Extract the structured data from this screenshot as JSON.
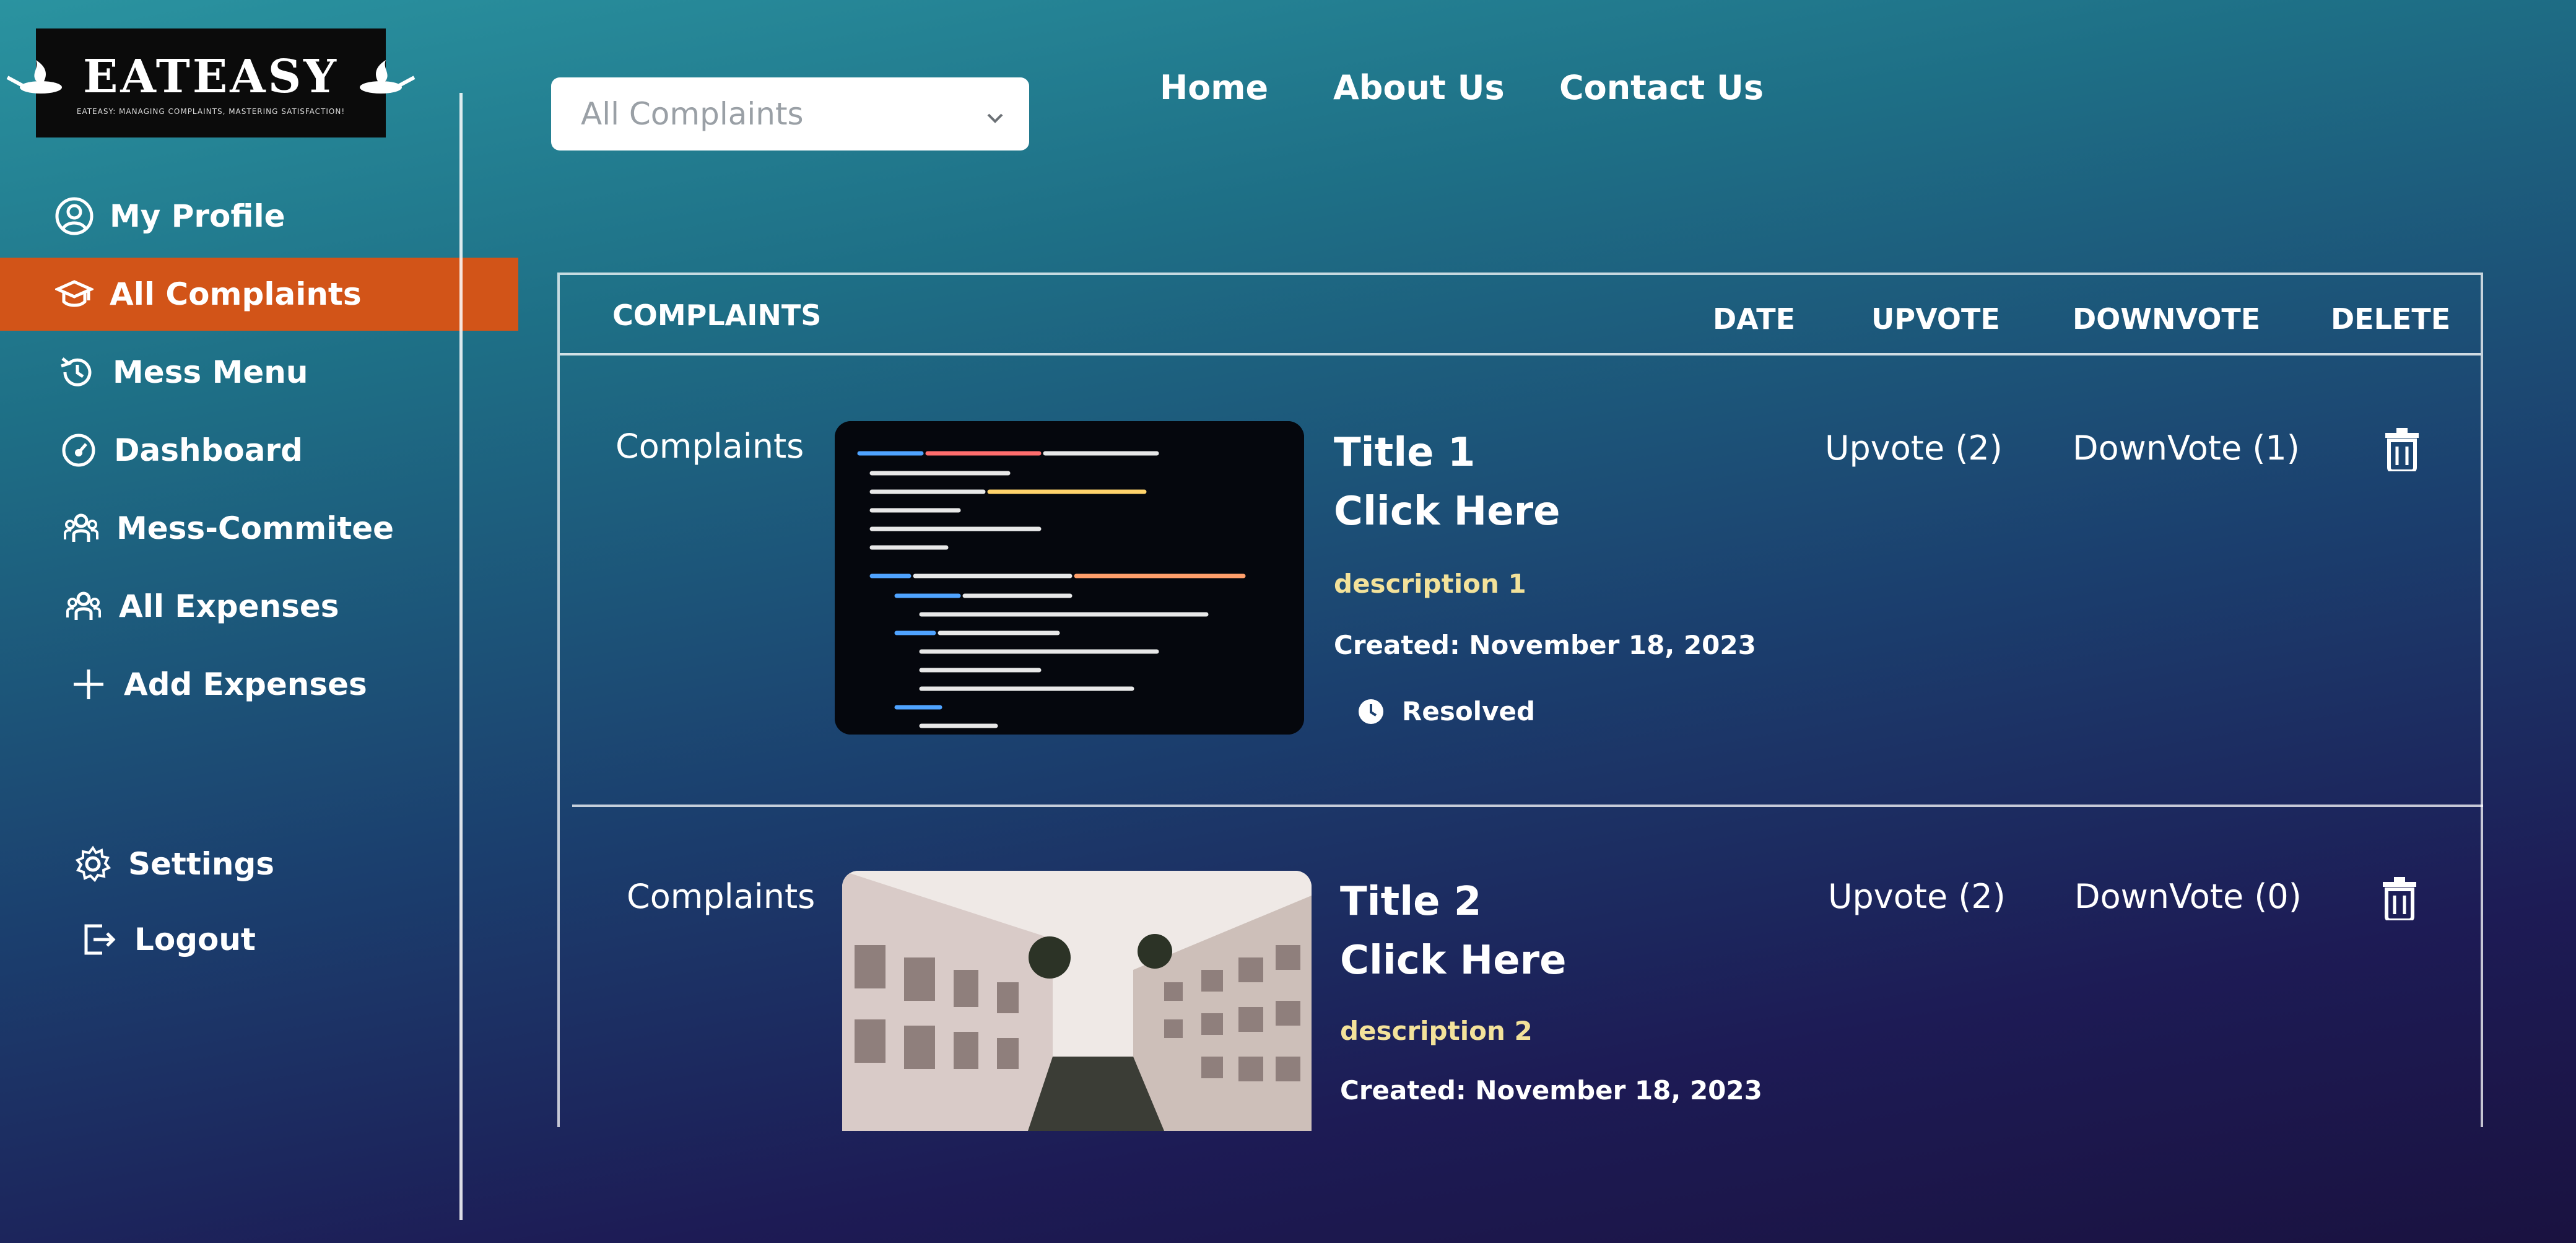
{
  "brand": {
    "name": "EATEASY",
    "tagline": "EATEASY: MANAGING COMPLAINTS, MASTERING SATISFACTION!"
  },
  "sidebar": {
    "items": [
      {
        "label": "My Profile",
        "icon": "user-circle-icon"
      },
      {
        "label": "All Complaints",
        "icon": "graduation-cap-icon",
        "active": true
      },
      {
        "label": "Mess Menu",
        "icon": "history-icon"
      },
      {
        "label": "Dashboard",
        "icon": "gauge-icon"
      },
      {
        "label": "Mess-Commitee",
        "icon": "group-icon"
      },
      {
        "label": "All Expenses",
        "icon": "group-icon"
      },
      {
        "label": "Add Expenses",
        "icon": "plus-icon"
      }
    ],
    "bottom": [
      {
        "label": "Settings",
        "icon": "gear-icon"
      },
      {
        "label": "Logout",
        "icon": "logout-icon"
      }
    ]
  },
  "filter": {
    "selected": "All Complaints"
  },
  "nav": {
    "home": "Home",
    "about": "About Us",
    "contact": "Contact Us"
  },
  "table": {
    "headers": {
      "complaints": "COMPLAINTS",
      "date": "DATE",
      "upvote": "UPVOTE",
      "downvote": "DOWNVOTE",
      "delete": "DELETE"
    },
    "rows": [
      {
        "category": "Complaints",
        "title": "Title 1",
        "link": "Click Here",
        "description": "description 1",
        "created": "Created: November 18, 2023",
        "status": "Resolved",
        "upvote": "Upvote (2)",
        "downvote": "DownVote (1)"
      },
      {
        "category": "Complaints",
        "title": "Title 2",
        "link": "Click Here",
        "description": "description 2",
        "created": "Created: November 18, 2023",
        "upvote": "Upvote (2)",
        "downvote": "DownVote (0)"
      }
    ]
  },
  "colors": {
    "active": "#d25418",
    "description": "#f3e29a"
  }
}
